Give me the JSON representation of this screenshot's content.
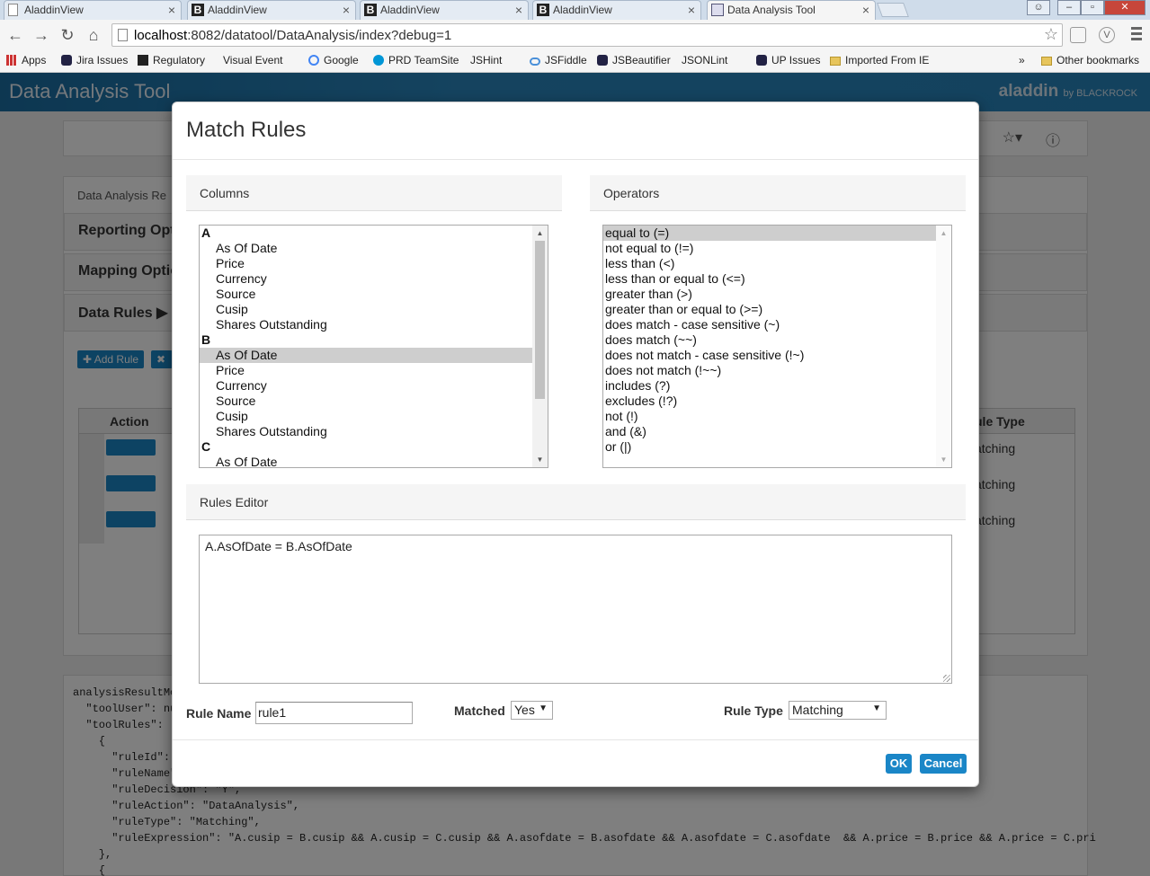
{
  "browser": {
    "tabs": [
      {
        "title": "AladdinView",
        "icon": "doc"
      },
      {
        "title": "AladdinView",
        "icon": "b"
      },
      {
        "title": "AladdinView",
        "icon": "b"
      },
      {
        "title": "AladdinView",
        "icon": "b"
      },
      {
        "title": "Data Analysis Tool",
        "icon": "img"
      }
    ],
    "url_host": "localhost",
    "url_rest": ":8082/datatool/DataAnalysis/index?debug=1",
    "bookmarks": [
      {
        "label": "Apps",
        "icon": "grid"
      },
      {
        "label": "Jira Issues",
        "icon": "bug"
      },
      {
        "label": "Regulatory",
        "icon": "bb"
      },
      {
        "label": "Visual Event",
        "icon": "page"
      },
      {
        "label": "Google",
        "icon": "g"
      },
      {
        "label": "PRD TeamSite",
        "icon": "hp"
      },
      {
        "label": "JSHint",
        "icon": "page"
      },
      {
        "label": "JSFiddle",
        "icon": "cloud"
      },
      {
        "label": "JSBeautifier",
        "icon": "bug"
      },
      {
        "label": "JSONLint",
        "icon": "page"
      },
      {
        "label": "UP Issues",
        "icon": "bug"
      },
      {
        "label": "Imported From IE",
        "icon": "folder"
      }
    ],
    "overflow_chevron": "»",
    "other_bookmarks": "Other bookmarks"
  },
  "app": {
    "title": "Data Analysis Tool",
    "brand": "aladdin",
    "brand_suffix": "by BLACKROCK",
    "background": {
      "breadcrumb": "Data Analysis Re",
      "reporting": "Reporting Opt",
      "mapping": "Mapping Optio",
      "data_rules": "Data Rules",
      "add_rule": "Add Rule",
      "action_header": "Action",
      "rule_type_header": "ule Type",
      "rule_type_values": [
        "atching",
        "atching",
        "atching"
      ],
      "code_lines": [
        "analysisResultMo",
        "  \"toolUser\": nu",
        "  \"toolRules\": [",
        "    {",
        "      \"ruleId\":",
        "      \"ruleName\"",
        "      \"ruleDecision\": \"Y\",",
        "      \"ruleAction\": \"DataAnalysis\",",
        "      \"ruleType\": \"Matching\",",
        "      \"ruleExpression\": \"A.cusip = B.cusip && A.cusip = C.cusip && A.asofdate = B.asofdate && A.asofdate = C.asofdate  && A.price = B.price && A.price = C.pri",
        "    },",
        "    {"
      ]
    }
  },
  "modal": {
    "title": "Match Rules",
    "columns_header": "Columns",
    "operators_header": "Operators",
    "editor_header": "Rules Editor",
    "columns": [
      {
        "label": "A",
        "group": true
      },
      {
        "label": "As Of Date"
      },
      {
        "label": "Price"
      },
      {
        "label": "Currency"
      },
      {
        "label": "Source"
      },
      {
        "label": "Cusip"
      },
      {
        "label": "Shares Outstanding"
      },
      {
        "label": "B",
        "group": true
      },
      {
        "label": "As Of Date",
        "selected": true
      },
      {
        "label": "Price"
      },
      {
        "label": "Currency"
      },
      {
        "label": "Source"
      },
      {
        "label": "Cusip"
      },
      {
        "label": "Shares Outstanding"
      },
      {
        "label": "C",
        "group": true
      },
      {
        "label": "As Of Date"
      }
    ],
    "operators": [
      {
        "label": "equal to (=)",
        "selected": true
      },
      {
        "label": "not equal to (!=)"
      },
      {
        "label": "less than (<)"
      },
      {
        "label": "less than or equal to (<=)"
      },
      {
        "label": "greater than (>)"
      },
      {
        "label": "greater than or equal to (>=)"
      },
      {
        "label": "does match - case sensitive (~)"
      },
      {
        "label": "does match (~~)"
      },
      {
        "label": "does not match - case sensitive (!~)"
      },
      {
        "label": "does not match (!~~)"
      },
      {
        "label": "includes (?)"
      },
      {
        "label": "excludes (!?)"
      },
      {
        "label": "not (!)"
      },
      {
        "label": "and (&)"
      },
      {
        "label": "or (|)"
      }
    ],
    "rule_expression": "A.AsOfDate = B.AsOfDate",
    "rule_name_label": "Rule Name",
    "rule_name_value": "rule1",
    "matched_label": "Matched",
    "matched_value": "Yes",
    "rule_type_label": "Rule Type",
    "rule_type_value": "Matching",
    "ok_label": "OK",
    "cancel_label": "Cancel"
  },
  "colors": {
    "accent": "#1a86c7",
    "header": "#2a87bf",
    "selection": "#cecece"
  }
}
